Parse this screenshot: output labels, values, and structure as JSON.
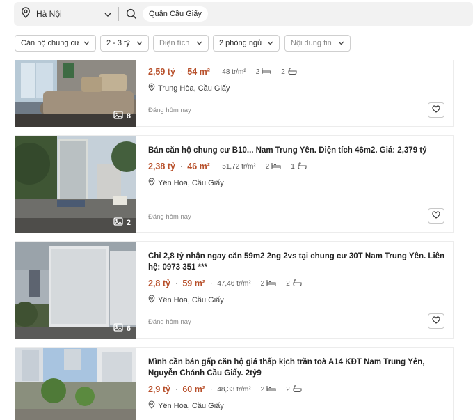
{
  "search": {
    "location": "Hà Nội",
    "chip": "Quận Cầu Giấy"
  },
  "filters": [
    {
      "label": "Căn hộ chung cư",
      "muted": false
    },
    {
      "label": "2 - 3 tỷ",
      "muted": false
    },
    {
      "label": "Diện tích",
      "muted": true
    },
    {
      "label": "2 phòng ngủ",
      "muted": false
    },
    {
      "label": "Nội dung tin",
      "muted": true
    }
  ],
  "listings": [
    {
      "title": "",
      "price": "2,59 tỷ",
      "area": "54 m²",
      "ppm": "48 tr/m²",
      "beds": "2",
      "baths": "2",
      "address": "Trung Hòa, Cầu Giấy",
      "posted": "Đăng hôm nay",
      "photos": "8"
    },
    {
      "title": "Bán căn hộ chung cư B10... Nam Trung Yên. Diện tích 46m2. Giá: 2,379 tỷ",
      "price": "2,38 tỷ",
      "area": "46 m²",
      "ppm": "51,72 tr/m²",
      "beds": "2",
      "baths": "1",
      "address": "Yên Hòa, Cầu Giấy",
      "posted": "Đăng hôm nay",
      "photos": "2"
    },
    {
      "title": "Chỉ 2,8 tỷ nhận ngay căn 59m2 2ng 2vs tại chung cư 30T Nam Trung Yên. Liên hệ: 0973 351 ***",
      "price": "2,8 tỷ",
      "area": "59 m²",
      "ppm": "47,46 tr/m²",
      "beds": "2",
      "baths": "2",
      "address": "Yên Hòa, Cầu Giấy",
      "posted": "Đăng hôm nay",
      "photos": "6"
    },
    {
      "title": "Mình cần bán gấp căn hộ giá thấp kịch trần toà A14 KĐT Nam Trung Yên, Nguyễn Chánh Cầu Giấy. 2tỷ9",
      "price": "2,9 tỷ",
      "area": "60 m²",
      "ppm": "48,33 tr/m²",
      "beds": "2",
      "baths": "2",
      "address": "Yên Hòa, Cầu Giấy",
      "posted": "",
      "photos": ""
    }
  ]
}
